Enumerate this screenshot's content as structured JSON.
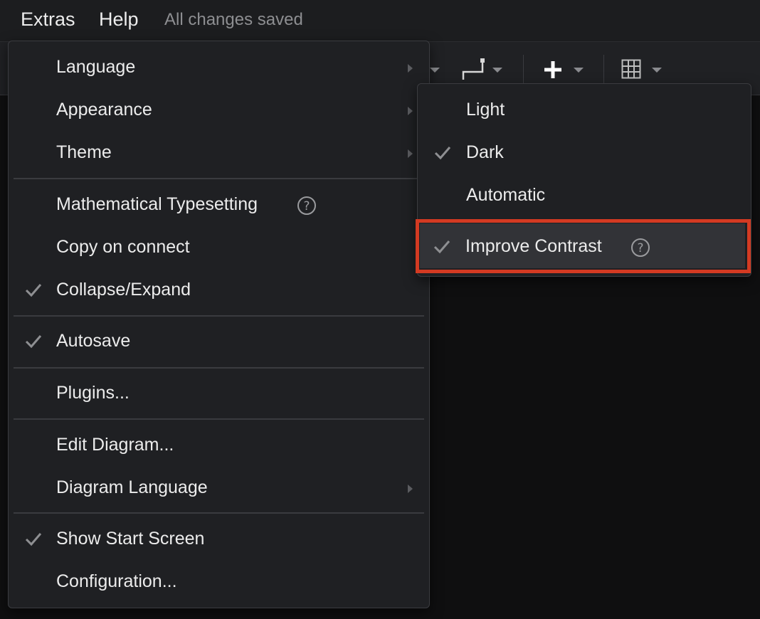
{
  "menubar": {
    "extras": "Extras",
    "help": "Help",
    "status": "All changes saved"
  },
  "toolbar": {
    "icons": [
      "waypoint-icon",
      "plus-icon",
      "table-icon"
    ]
  },
  "extras_menu": {
    "items": [
      {
        "label": "Language",
        "checked": false,
        "submenu": true
      },
      {
        "label": "Appearance",
        "checked": false,
        "submenu": true
      },
      {
        "label": "Theme",
        "checked": false,
        "submenu": true
      },
      {
        "label": "Mathematical Typesetting",
        "checked": false,
        "help": true
      },
      {
        "label": "Copy on connect",
        "checked": false
      },
      {
        "label": "Collapse/Expand",
        "checked": true
      },
      {
        "label": "Autosave",
        "checked": true
      },
      {
        "label": "Plugins...",
        "checked": false
      },
      {
        "label": "Edit Diagram...",
        "checked": false
      },
      {
        "label": "Diagram Language",
        "checked": false,
        "submenu": true
      },
      {
        "label": "Show Start Screen",
        "checked": true
      },
      {
        "label": "Configuration...",
        "checked": false
      }
    ]
  },
  "theme_submenu": {
    "items": [
      {
        "label": "Light",
        "checked": false
      },
      {
        "label": "Dark",
        "checked": true
      },
      {
        "label": "Automatic",
        "checked": false
      },
      {
        "label": "Improve Contrast",
        "checked": true,
        "help": true,
        "highlighted": true
      }
    ]
  },
  "colors": {
    "highlight_border": "#d33a22",
    "menu_bg": "#1f2023"
  }
}
